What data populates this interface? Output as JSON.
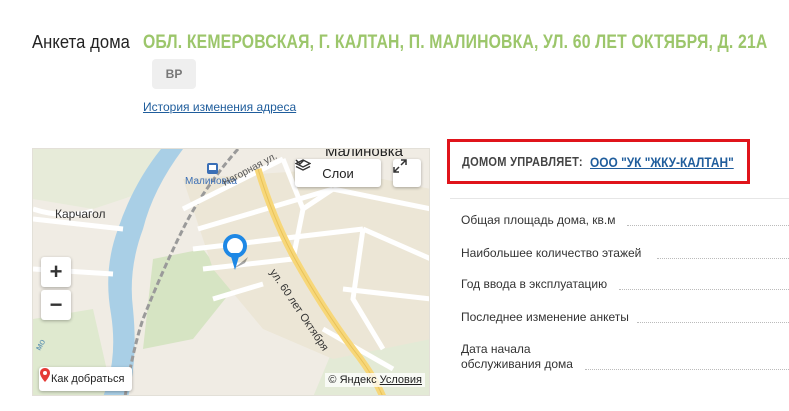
{
  "header": {
    "label": "Анкета дома",
    "address": "ОБЛ. КЕМЕРОВСКАЯ, Г. КАЛТАН, П. МАЛИНОВКА, УЛ. 60 ЛЕТ ОКТЯБРЯ, Д. 21А",
    "badge": "ВР",
    "history_link": "История изменения адреса"
  },
  "map": {
    "labels": {
      "district": "Малиновка",
      "station": "Малиновка",
      "street_nagornaya": "Нагорная ул.",
      "street_60": "ул. 60 лет Октября",
      "village": "Карчагол",
      "edge": "мо"
    },
    "layers_label": "Слои",
    "zoom_in": "+",
    "zoom_out": "−",
    "route_label": "Как добраться",
    "copyright": "© Яндекс",
    "terms": "Условия",
    "colors": {
      "river": "#a9cfe6",
      "park": "#d6e4c3",
      "road_major": "#f7d779",
      "road_minor": "#ffffff",
      "railway": "#9a9a9a",
      "pin": "#1e88e5"
    }
  },
  "management": {
    "label": "ДОМОМ УПРАВЛЯЕТ:",
    "company": "ООО \"УК \"ЖКУ-КАЛТАН\"",
    "border_color": "#e0141b"
  },
  "info": {
    "total_area": "Общая площадь дома, кв.м",
    "max_floors": "Наибольшее количество этажей",
    "year_built": "Год ввода в эксплуатацию",
    "last_change": "Последнее изменение анкеты",
    "service_start_line1": "Дата начала",
    "service_start_line2": "обслуживания дома"
  }
}
